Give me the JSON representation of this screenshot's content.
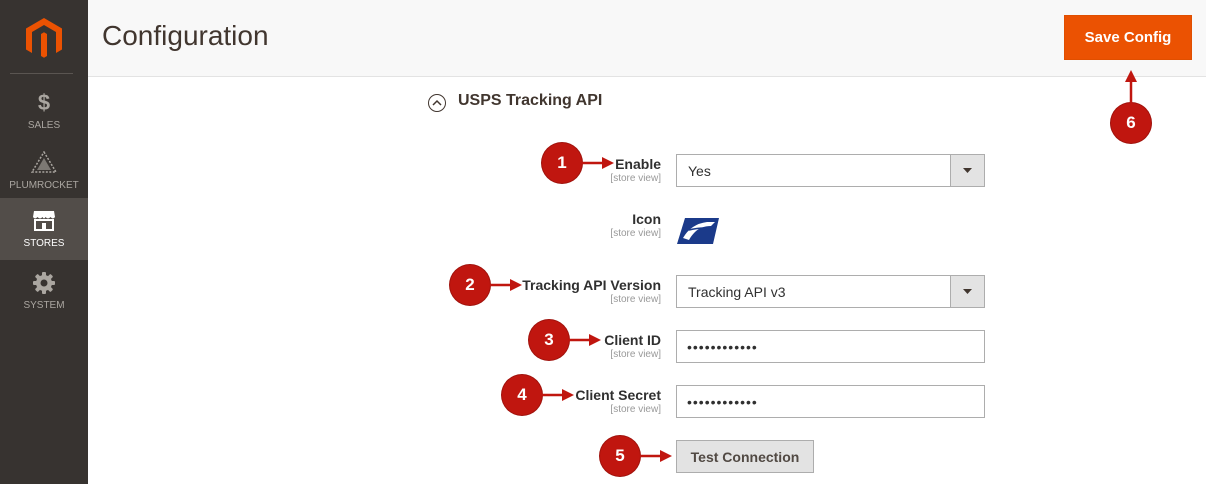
{
  "sidebar": {
    "logo": "magento-logo",
    "items": [
      {
        "label": "SALES",
        "icon": "dollar-icon"
      },
      {
        "label": "PLUMROCKET",
        "icon": "plumrocket-icon"
      },
      {
        "label": "STORES",
        "icon": "store-icon",
        "active": true
      },
      {
        "label": "SYSTEM",
        "icon": "gear-icon"
      }
    ]
  },
  "header": {
    "title": "Configuration",
    "save_label": "Save Config"
  },
  "section": {
    "title": "USPS Tracking API",
    "icon": "collapse-chevron-icon"
  },
  "fields": {
    "enable": {
      "label": "Enable",
      "scope": "[store view]",
      "value": "Yes"
    },
    "icon": {
      "label": "Icon",
      "scope": "[store view]",
      "image": "usps-eagle-icon"
    },
    "version": {
      "label": "Tracking API Version",
      "scope": "[store view]",
      "value": "Tracking API v3"
    },
    "client_id": {
      "label": "Client ID",
      "scope": "[store view]",
      "value": "••••••••••••"
    },
    "client_secret": {
      "label": "Client Secret",
      "scope": "[store view]",
      "value": "••••••••••••"
    }
  },
  "test_button": "Test Connection",
  "markers": [
    "1",
    "2",
    "3",
    "4",
    "5",
    "6"
  ],
  "colors": {
    "accent": "#eb5202",
    "marker": "#c0160f",
    "sidebar": "#373330"
  }
}
